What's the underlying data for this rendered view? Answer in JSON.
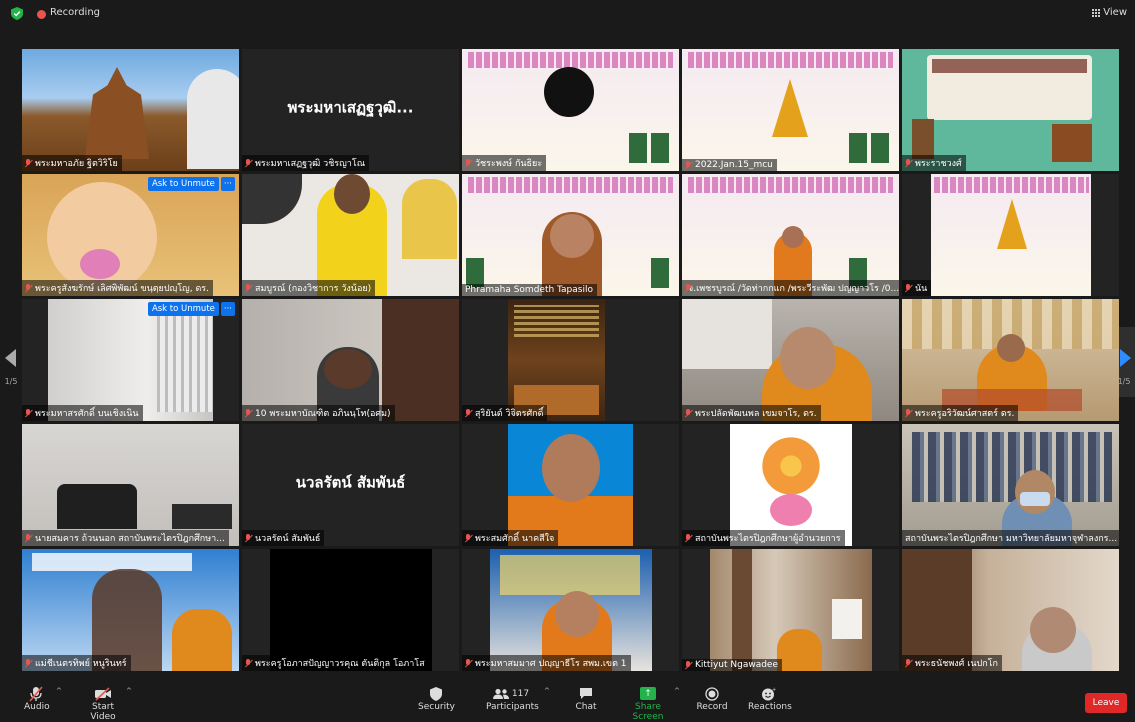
{
  "topbar": {
    "recording_label": "Recording",
    "view_label": "View"
  },
  "nav": {
    "page_left": "1/5",
    "page_right": "1/5"
  },
  "tiles": [
    {
      "name": "พระมหาอภัย ฐิตวิริโย"
    },
    {
      "name": "พระมหาเสฏฐวุฒิ วชิรญาโณ",
      "display": "พระมหาเสฏฐวุฒิ..."
    },
    {
      "name": "วัชระพงษ์ กันธิยะ"
    },
    {
      "name": "2022.Jan.15_mcu"
    },
    {
      "name": "พระราชวงศ์"
    },
    {
      "name": "พระครูสังฆรักษ์ เลิศพิพัฒน์ ขนฺตฺยปญฺโญ, ดร.",
      "unmute": "Ask to Unmute"
    },
    {
      "name": "สมบูรณ์ (กองวิชาการ วังน้อย)"
    },
    {
      "name": "Phramaha Somdeth Tapasilo"
    },
    {
      "name": "จ.เพชรบูรณ์ /วัดท่ากกแก /พระวีระพัฒ ปญญาวโร /0..."
    },
    {
      "name": "นัน"
    },
    {
      "name": "พระมหาสรศักดิ์ บนเชิงเนิน",
      "unmute": "Ask to Unmute"
    },
    {
      "name": "10 พระมหาบัณฑิต อภินนฺโท(อศม)"
    },
    {
      "name": "สุริยันต์ วิจิตรศักดิ์"
    },
    {
      "name": "พระปลัดพัฒนพล เขมจาโร, ดร."
    },
    {
      "name": "พระครูอริวัฒน์ศาสตร์ ดร."
    },
    {
      "name": "นายสมคาร ถ้วนนอก สถาบันพระไตรปิฎกศึกษา..."
    },
    {
      "name": "นวลรัตน์ สัมพันธ์",
      "display": "นวลรัตน์ สัมพันธ์"
    },
    {
      "name": "พระสมศักดิ์ นาคสีใจ"
    },
    {
      "name": "สถาบันพระไตรปิฎกศึกษาผู้อำนวยการ"
    },
    {
      "name": "สถาบันพระไตรปิฎกศึกษา มหาวิทยาลัยมหาจุฬาลงกร..."
    },
    {
      "name": "แม่ชีเนตรทิพย์ หนูรินทร์"
    },
    {
      "name": "พระครูโอภาสปัญญาวรคุณ ตันติกุล โอภาโส"
    },
    {
      "name": "พระมหาสมมาศ ปญฺญาธีโร สพม.เขต 1"
    },
    {
      "name": "Kittiyut Ngawadee"
    },
    {
      "name": "พระธนัชพงศ์ เนปกโก"
    }
  ],
  "toolbar": {
    "audio": "Audio",
    "video": "Start Video",
    "security": "Security",
    "participants": "Participants",
    "participants_count": "117",
    "chat": "Chat",
    "share": "Share Screen",
    "record": "Record",
    "reactions": "Reactions",
    "leave": "Leave"
  },
  "colors": {
    "accent": "#0e72ed",
    "share_green": "#24b24a",
    "leave_red": "#e02828",
    "active_speaker": "#d6e54a"
  }
}
